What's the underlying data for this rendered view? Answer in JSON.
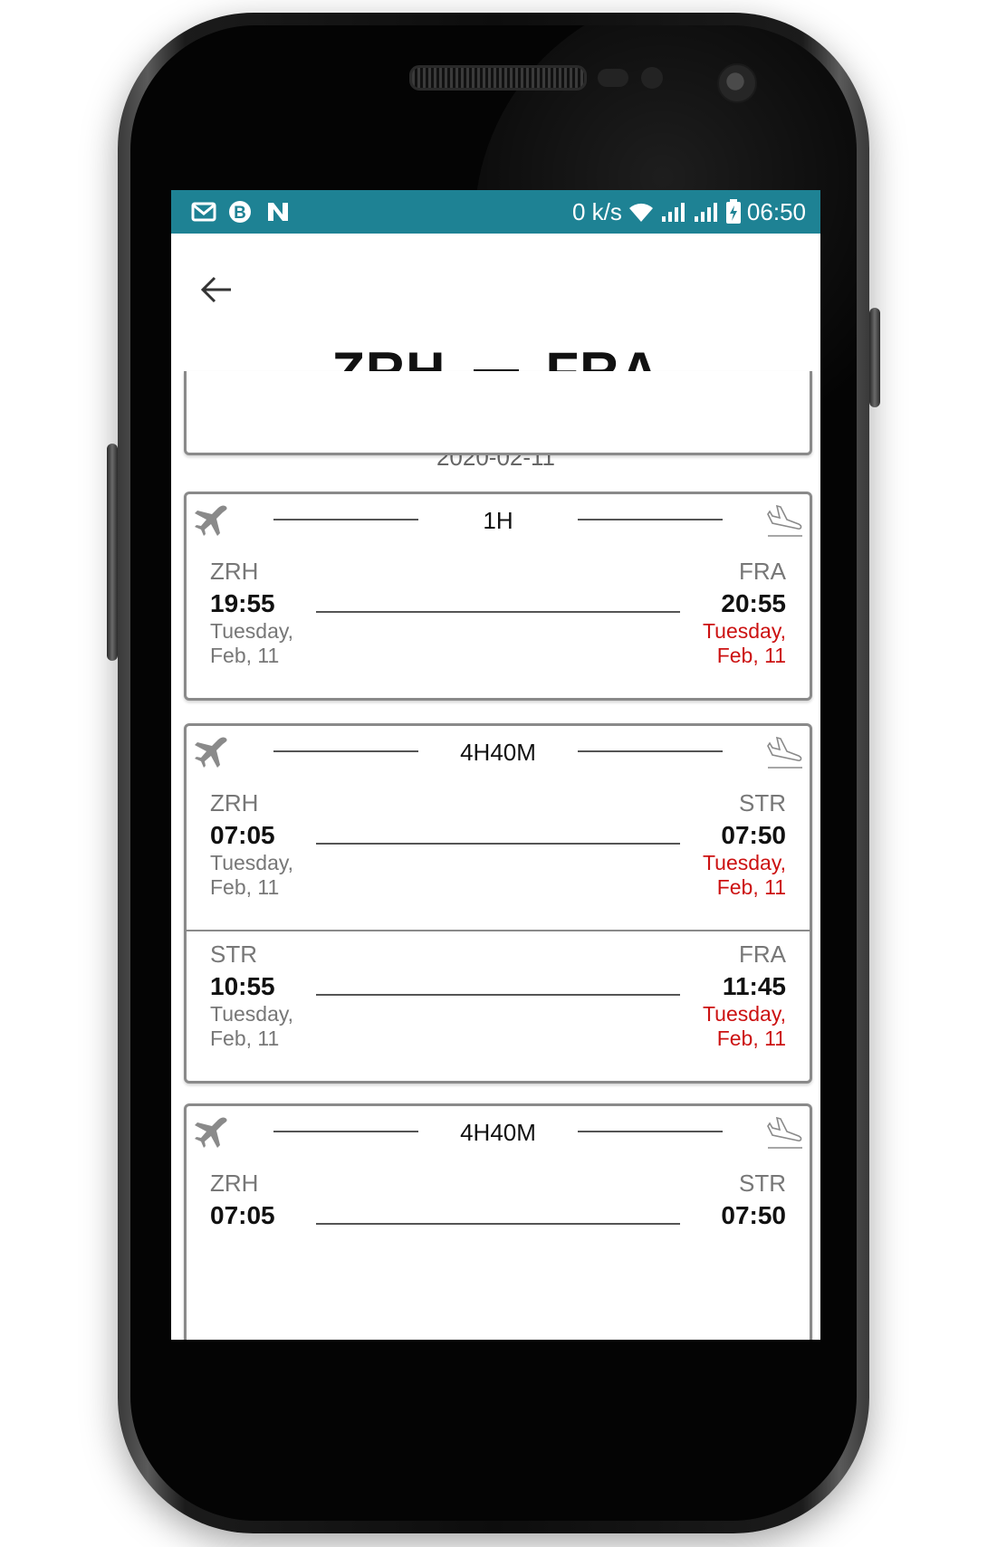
{
  "status_bar": {
    "left_icons": [
      "gmail-icon",
      "b-app-icon",
      "n-app-icon"
    ],
    "speed": "0 k/s",
    "time": "06:50",
    "color": "#1e8294"
  },
  "header": {
    "origin": "ZRH",
    "destination": "FRA",
    "date": "2020-02-11"
  },
  "cards": [
    {
      "duration": "1H",
      "legs": [
        {
          "from": "ZRH",
          "dep_time": "19:55",
          "dep_day": "Tuesday,",
          "dep_date": "Feb, 11",
          "to": "FRA",
          "arr_time": "20:55",
          "arr_day": "Tuesday,",
          "arr_date": "Feb, 11"
        }
      ]
    },
    {
      "duration": "4H40M",
      "legs": [
        {
          "from": "ZRH",
          "dep_time": "07:05",
          "dep_day": "Tuesday,",
          "dep_date": "Feb, 11",
          "to": "STR",
          "arr_time": "07:50",
          "arr_day": "Tuesday,",
          "arr_date": "Feb, 11"
        },
        {
          "from": "STR",
          "dep_time": "10:55",
          "dep_day": "Tuesday,",
          "dep_date": "Feb, 11",
          "to": "FRA",
          "arr_time": "11:45",
          "arr_day": "Tuesday,",
          "arr_date": "Feb, 11"
        }
      ]
    },
    {
      "duration": "4H40M",
      "legs": [
        {
          "from": "ZRH",
          "dep_time": "07:05",
          "to": "STR",
          "arr_time": "07:50"
        }
      ]
    }
  ],
  "colors": {
    "arrival_date": "#cc1111",
    "border": "#8a8a8a"
  }
}
